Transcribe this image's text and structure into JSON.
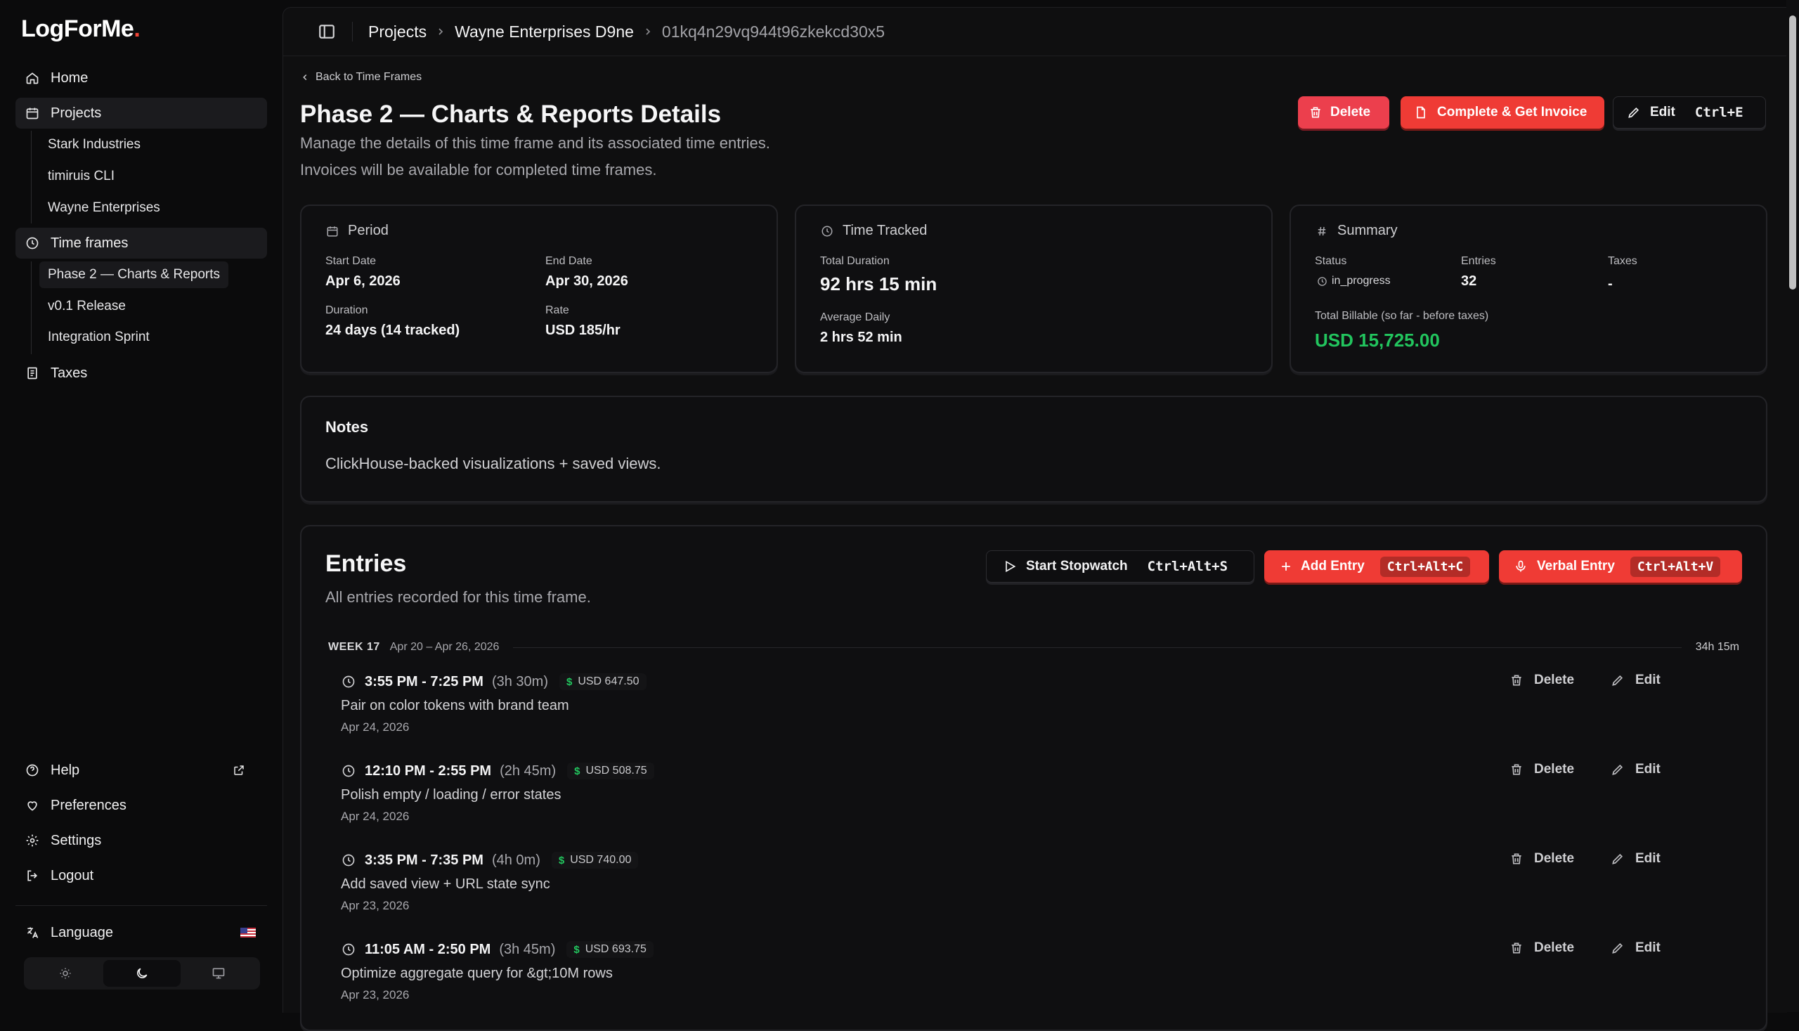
{
  "app": {
    "logo_text": "LogForMe",
    "logo_dot": "."
  },
  "sidebar": {
    "nav": {
      "home": "Home",
      "projects": "Projects",
      "time_frames": "Time frames",
      "taxes": "Taxes"
    },
    "projects": [
      "Stark Industries",
      "timiruis CLI",
      "Wayne Enterprises"
    ],
    "time_frames": [
      "Phase 2 — Charts & Reports",
      "v0.1 Release",
      "Integration Sprint"
    ],
    "bottom": {
      "help": "Help",
      "preferences": "Preferences",
      "settings": "Settings",
      "logout": "Logout",
      "language": "Language"
    },
    "theme": {
      "active": "dark",
      "options": [
        "sun-icon",
        "moon-icon",
        "monitor-icon"
      ]
    }
  },
  "breadcrumb": {
    "items": [
      "Projects",
      "Wayne Enterprises D9ne",
      "01kq4n29vq944t96zkekcd30x5"
    ]
  },
  "page": {
    "back_link": "Back to Time Frames",
    "title": "Phase 2 — Charts & Reports Details",
    "subtitle_1": "Manage the details of this time frame and its associated time entries.",
    "subtitle_2": "Invoices will be available for completed time frames."
  },
  "actions": {
    "delete": "Delete",
    "complete_invoice": "Complete & Get Invoice",
    "edit": "Edit",
    "edit_shortcut": "Ctrl+E"
  },
  "period": {
    "title": "Period",
    "start_label": "Start Date",
    "start_value": "Apr 6, 2026",
    "end_label": "End Date",
    "end_value": "Apr 30, 2026",
    "duration_label": "Duration",
    "duration_value": "24 days (14 tracked)",
    "rate_label": "Rate",
    "rate_value": "USD 185/hr"
  },
  "time_tracked": {
    "title": "Time Tracked",
    "total_label": "Total Duration",
    "total_value": "92 hrs 15 min",
    "avg_label": "Average Daily",
    "avg_value": "2 hrs 52 min"
  },
  "summary": {
    "title": "Summary",
    "status_label": "Status",
    "status_value": "in_progress",
    "entries_label": "Entries",
    "entries_value": "32",
    "taxes_label": "Taxes",
    "taxes_value": "-",
    "billable_label": "Total Billable (so far - before taxes)",
    "billable_value": "USD 15,725.00"
  },
  "notes": {
    "title": "Notes",
    "body": "ClickHouse-backed visualizations + saved views."
  },
  "entries": {
    "title": "Entries",
    "subtitle": "All entries recorded for this time frame.",
    "start_stopwatch": "Start Stopwatch",
    "start_stopwatch_kbd": "Ctrl+Alt+S",
    "add_entry": "Add Entry",
    "add_entry_kbd": "Ctrl+Alt+C",
    "verbal_entry": "Verbal Entry",
    "verbal_entry_kbd": "Ctrl+Alt+V",
    "week": {
      "label": "WEEK 17",
      "range": "Apr 20 – Apr 26, 2026",
      "total": "34h 15m"
    },
    "delete_label": "Delete",
    "edit_label": "Edit",
    "rows": [
      {
        "range": "3:55 PM - 7:25 PM",
        "duration": "(3h 30m)",
        "amount": "USD 647.50",
        "desc": "Pair on color tokens with brand team",
        "date": "Apr 24, 2026"
      },
      {
        "range": "12:10 PM - 2:55 PM",
        "duration": "(2h 45m)",
        "amount": "USD 508.75",
        "desc": "Polish empty / loading / error states",
        "date": "Apr 24, 2026"
      },
      {
        "range": "3:35 PM - 7:35 PM",
        "duration": "(4h 0m)",
        "amount": "USD 740.00",
        "desc": "Add saved view + URL state sync",
        "date": "Apr 23, 2026"
      },
      {
        "range": "11:05 AM - 2:50 PM",
        "duration": "(3h 45m)",
        "amount": "USD 693.75",
        "desc": "Optimize aggregate query for &gt;10M rows",
        "date": "Apr 23, 2026"
      }
    ]
  },
  "colors": {
    "accent": "#ef3b35",
    "delete": "#ec3f4d",
    "money": "#22c55e",
    "background": "#0b0b0c"
  }
}
